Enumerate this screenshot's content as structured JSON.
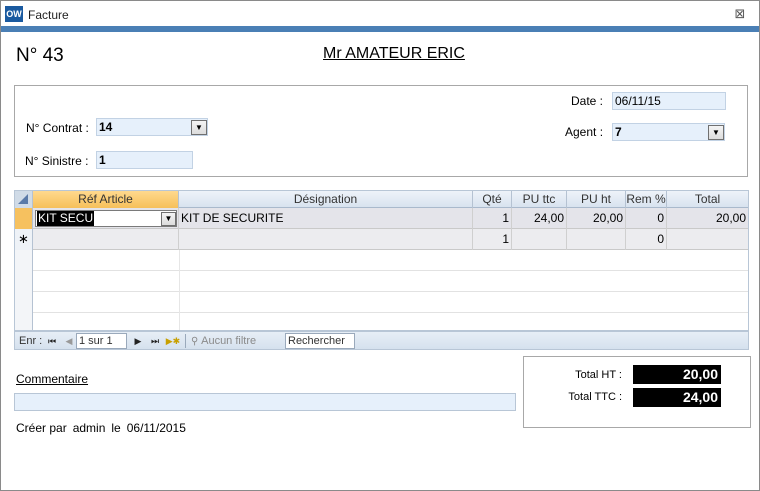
{
  "window": {
    "icon_text": "OW",
    "title": "Facture",
    "close_symbol": "⊠",
    "accent_color": "#4a7fb5"
  },
  "header": {
    "invoice_number": "N°  43",
    "client_name": "Mr AMATEUR ERIC"
  },
  "form": {
    "date_label": "Date :",
    "date_value": "06/11/15",
    "contrat_label": "N° Contrat :",
    "contrat_value": "14",
    "agent_label": "Agent :",
    "agent_value": "7",
    "sinistre_label": "N° Sinistre :",
    "sinistre_value": "1",
    "field_bg_color": "#e6f0fb"
  },
  "grid": {
    "columns": [
      "Réf Article",
      "Désignation",
      "Qté",
      "PU ttc",
      "PU ht",
      "Rem %",
      "Total"
    ],
    "rows": [
      {
        "ref": "KIT SECU",
        "designation": "KIT DE SECURITE",
        "qte": "1",
        "pu_ttc": "24,00",
        "pu_ht": "20,00",
        "rem": "0",
        "total": "20,00"
      }
    ],
    "new_row": {
      "marker": "∗",
      "qte": "1",
      "rem": "0"
    },
    "active_header_color": "#f6c05a"
  },
  "navigator": {
    "label": "Enr :",
    "first": "⏮",
    "prev": "◀",
    "position": "1 sur 1",
    "next": "▶",
    "last": "⏭",
    "new": "▶✱",
    "filter": "Aucun filtre",
    "search": "Rechercher"
  },
  "totals": {
    "ht_label": "Total HT :",
    "ht_value": "20,00",
    "ttc_label": "Total TTC :",
    "ttc_value": "24,00"
  },
  "comment": {
    "label": "Commentaire",
    "value": ""
  },
  "footer": {
    "created_by_label": "Créer par",
    "created_by_user": "admin",
    "created_on_label": "le",
    "created_on_date": "06/11/2015"
  }
}
